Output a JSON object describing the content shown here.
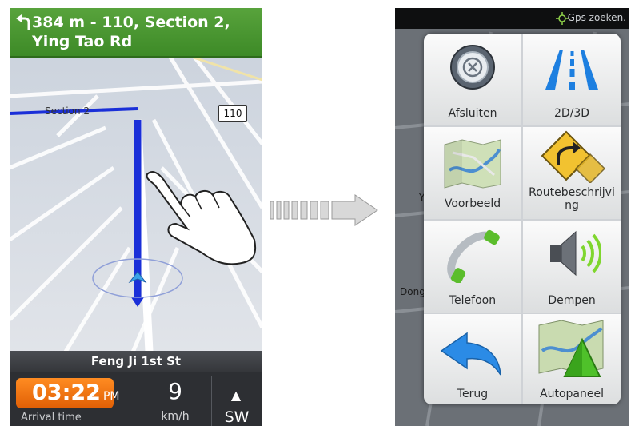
{
  "left_screen": {
    "nav_banner": {
      "instruction": "384 m - 110, Section 2, Ying Tao Rd"
    },
    "map": {
      "street_label": "Section 2",
      "route_shield": "110"
    },
    "bottom_bar": {
      "current_street": "Feng Ji 1st St",
      "arrival_time": "03:22",
      "arrival_period": "PM",
      "arrival_label": "Arrival time",
      "speed_value": "9",
      "speed_unit": "km/h",
      "heading": "SW"
    }
  },
  "right_screen": {
    "status_bar": {
      "gps_status": "Gps zoeken."
    },
    "menu": {
      "items": [
        {
          "label": "Afsluiten",
          "icon": "close-circle-icon"
        },
        {
          "label": "2D/3D",
          "icon": "perspective-road-icon"
        },
        {
          "label": "Voorbeeld",
          "icon": "map-preview-icon"
        },
        {
          "label": "Routebeschrijving",
          "icon": "turn-sign-icon"
        },
        {
          "label": "Telefoon",
          "icon": "phone-handset-icon"
        },
        {
          "label": "Dempen",
          "icon": "speaker-icon"
        },
        {
          "label": "Terug",
          "icon": "back-arrow-icon"
        },
        {
          "label": "Autopaneel",
          "icon": "car-panel-icon"
        }
      ]
    },
    "background_labels": [
      "Y",
      "Dong"
    ]
  },
  "colors": {
    "banner_green": "#4a9a30",
    "route_blue": "#1a2fd8",
    "time_orange": "#f07a12",
    "bar_dark": "#2d2f33"
  }
}
